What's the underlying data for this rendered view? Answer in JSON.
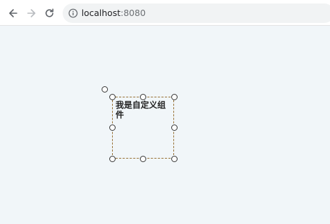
{
  "browser": {
    "back_icon": "arrow-left-icon",
    "forward_icon": "arrow-right-icon",
    "reload_icon": "reload-icon",
    "info_icon": "info-icon",
    "url_host": "localhost",
    "url_port": ":8080"
  },
  "component": {
    "text": "我是自定义组件",
    "border_color": "#c68a2e"
  },
  "colors": {
    "page_background": "#f1f6f9",
    "omnibox_background": "#f1f3f4"
  }
}
